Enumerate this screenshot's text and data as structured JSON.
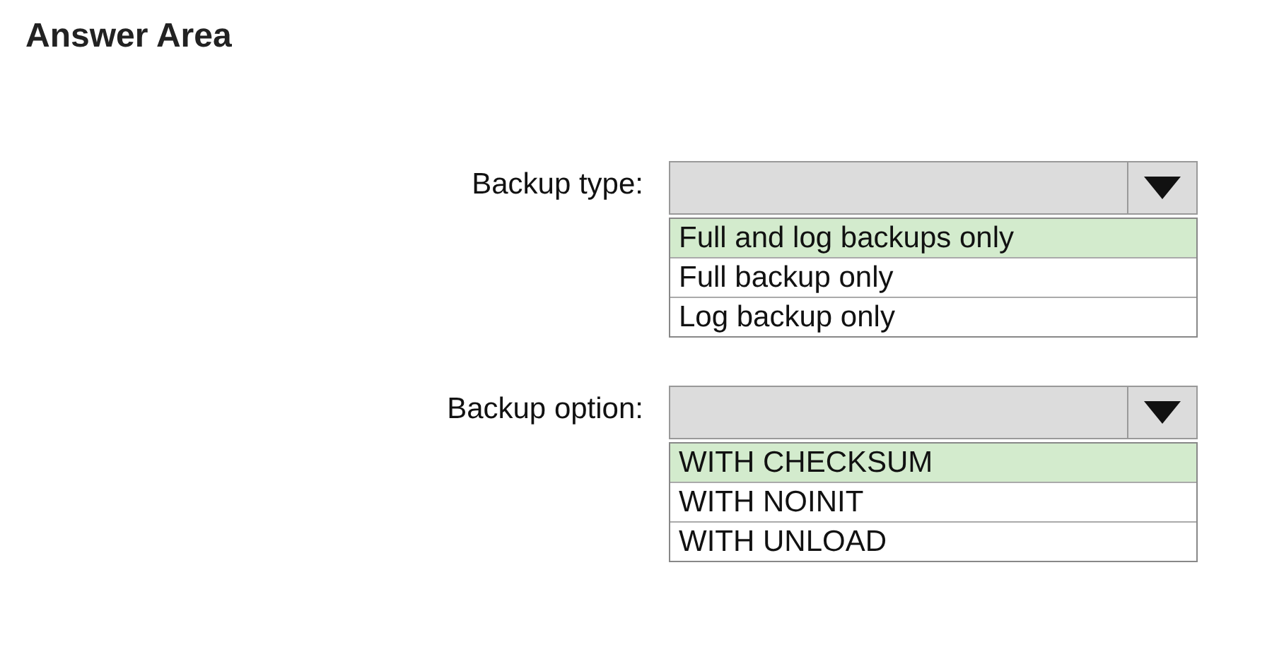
{
  "title": "Answer Area",
  "questions": [
    {
      "label": "Backup type:",
      "options": [
        {
          "text": "Full and log backups only",
          "selected": true
        },
        {
          "text": "Full backup only",
          "selected": false
        },
        {
          "text": "Log backup only",
          "selected": false
        }
      ]
    },
    {
      "label": "Backup option:",
      "options": [
        {
          "text": "WITH CHECKSUM",
          "selected": true
        },
        {
          "text": "WITH NOINIT",
          "selected": false
        },
        {
          "text": "WITH UNLOAD",
          "selected": false
        }
      ]
    }
  ]
}
